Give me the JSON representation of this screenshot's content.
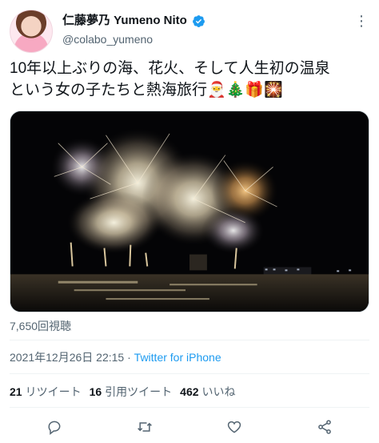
{
  "user": {
    "display_name": "仁藤夢乃 Yumeno Nito",
    "handle": "@colabo_yumeno"
  },
  "tweet": {
    "line1": "10年以上ぶりの海、花火、そして人生初の温泉",
    "line2": "という女の子たちと熱海旅行",
    "emojis": "🎅🎄🎁🎇"
  },
  "views": "7,650回視聴",
  "meta": {
    "timestamp": "2021年12月26日 22:15",
    "separator": " · ",
    "source": "Twitter for iPhone"
  },
  "stats": [
    {
      "count": "21",
      "label": "リツイート"
    },
    {
      "count": "16",
      "label": "引用ツイート"
    },
    {
      "count": "462",
      "label": "いいね"
    }
  ],
  "colors": {
    "accent": "#1d9bf0",
    "secondary_text": "#536471"
  },
  "icons": [
    "verified-badge-icon",
    "more-icon",
    "reply-icon",
    "retweet-icon",
    "like-icon",
    "share-icon"
  ]
}
